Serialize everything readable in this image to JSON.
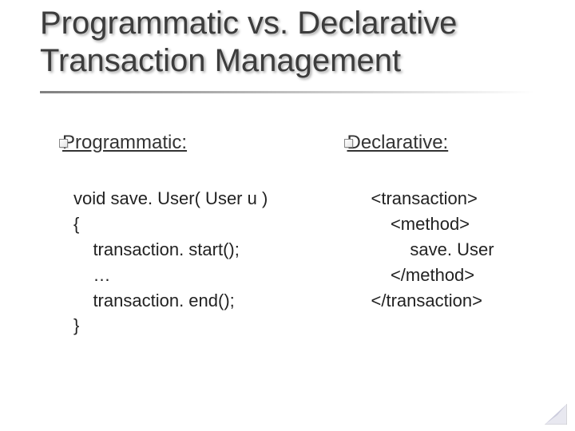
{
  "title_line1": "Programmatic vs. Declarative",
  "title_line2": "Transaction Management",
  "left": {
    "heading": "Programmatic:",
    "code": "void save. User( User u )\n{\n    transaction. start();\n    …\n    transaction. end();\n}"
  },
  "right": {
    "heading": "Declarative:",
    "code": "<transaction>\n    <method>\n        save. User\n    </method>\n</transaction>"
  }
}
